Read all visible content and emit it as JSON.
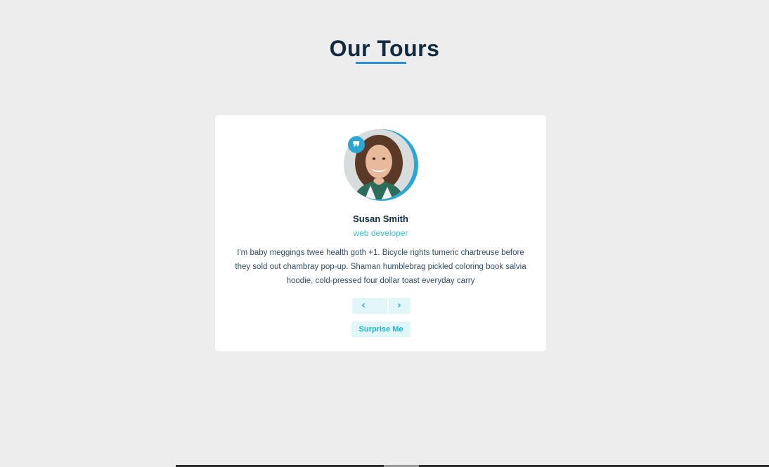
{
  "page": {
    "title": "Our Tours"
  },
  "review": {
    "name": "Susan Smith",
    "job": "web developer",
    "text": "I'm baby meggings twee health goth +1. Bicycle rights tumeric chartreuse before they sold out chambray pop-up. Shaman humblebrag pickled coloring book salvia hoodie, cold-pressed four dollar toast everyday carry"
  },
  "controls": {
    "prev_icon": "chevron-left-icon",
    "prev_glyph": "‹",
    "next_icon": "chevron-right-icon",
    "next_glyph": "›",
    "surprise_label": "Surprise Me"
  },
  "icons": {
    "quote": "quote-icon",
    "quote_glyph": "❞"
  },
  "colors": {
    "background": "#ededed",
    "title": "#102a42",
    "accent_underline": "#2b8fd8",
    "ring": "#2ca7d4",
    "job": "#3bc2d3",
    "button_bg": "#e0f6f9",
    "button_text": "#1fb3c9"
  }
}
